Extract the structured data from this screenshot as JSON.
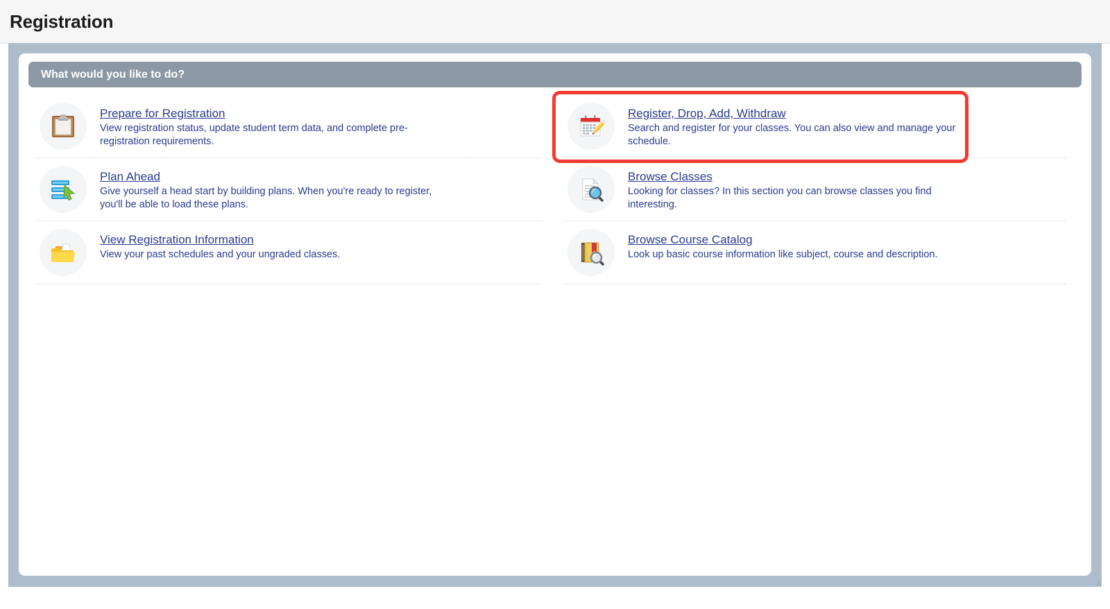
{
  "page": {
    "title": "Registration"
  },
  "section": {
    "header": "What would you like to do?"
  },
  "cards": {
    "left": [
      {
        "icon": "clipboard-icon",
        "title": "Prepare for Registration",
        "desc": "View registration status, update student term data, and complete pre-registration requirements."
      },
      {
        "icon": "plan-list-arrow-icon",
        "title": "Plan Ahead",
        "desc": "Give yourself a head start by building plans. When you're ready to register, you'll be able to load these plans."
      },
      {
        "icon": "open-folder-icon",
        "title": "View Registration Information",
        "desc": "View your past schedules and your ungraded classes."
      }
    ],
    "right": [
      {
        "icon": "calendar-pencil-icon",
        "title": "Register, Drop, Add, Withdraw",
        "desc": "Search and register for your classes. You can also view and manage your schedule."
      },
      {
        "icon": "document-search-icon",
        "title": "Browse Classes",
        "desc": "Looking for classes? In this section you can browse classes you find interesting."
      },
      {
        "icon": "book-search-icon",
        "title": "Browse Course Catalog",
        "desc": "Look up basic course information like subject, course and description."
      }
    ]
  },
  "annotation": {
    "highlight_target": "Register, Drop, Add, Withdraw",
    "highlight_color": "#f43b32"
  },
  "colors": {
    "frame": "#aebdcb",
    "section_header_bg": "#8c99a5",
    "link": "#2b3a8f",
    "titlebar_bg": "#f6f6f6"
  }
}
